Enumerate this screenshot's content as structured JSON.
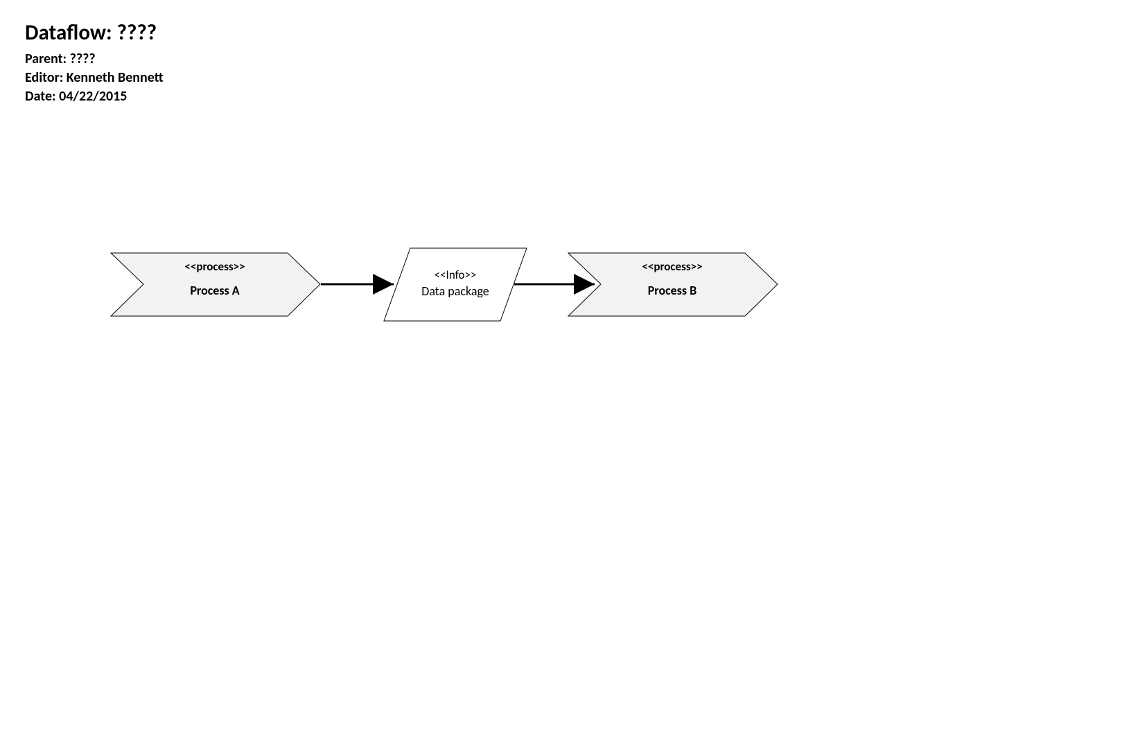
{
  "header": {
    "title_prefix": "Dataflow: ",
    "title_value": "????",
    "parent_prefix": "Parent: ",
    "parent_value": "????",
    "editor_prefix": "Editor: ",
    "editor_value": "Kenneth Bennett",
    "date_prefix": "Date: ",
    "date_value": "04/22/2015"
  },
  "nodes": {
    "process_a": {
      "stereotype": "<<process>>",
      "label": "Process A"
    },
    "info": {
      "stereotype": "<<Info>>",
      "label": "Data package"
    },
    "process_b": {
      "stereotype": "<<process>>",
      "label": "Process B"
    }
  }
}
